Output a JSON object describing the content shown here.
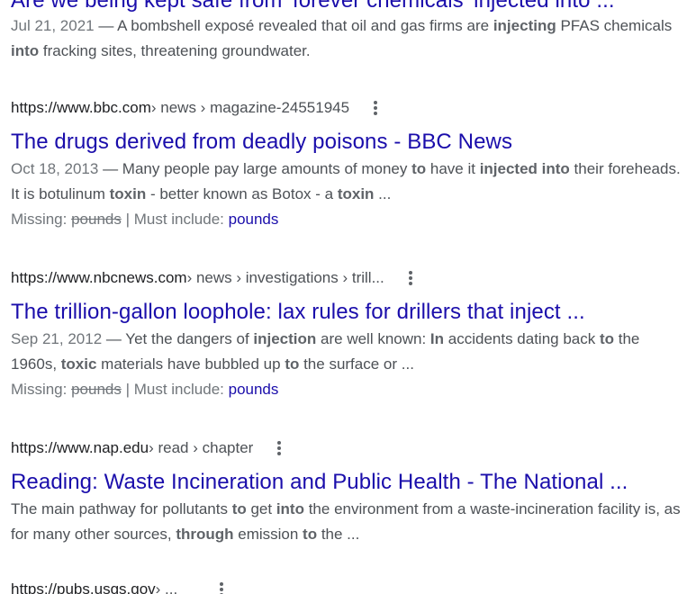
{
  "results": [
    {
      "title": "Are we being kept safe from 'forever chemicals' injected into ...",
      "date": "Jul 21, 2021",
      "snippet_parts": [
        {
          "t": " — A bombshell exposé revealed that oil and gas firms are ",
          "b": false
        },
        {
          "t": "injecting",
          "b": true
        },
        {
          "t": " PFAS chemicals ",
          "b": false
        },
        {
          "t": "into",
          "b": true
        },
        {
          "t": " fracking sites, threatening groundwater.",
          "b": false
        }
      ]
    },
    {
      "host": "https://www.bbc.com",
      "path": " › news › magazine-24551945",
      "title": "The drugs derived from deadly poisons - BBC News",
      "date": "Oct 18, 2013",
      "snippet_parts": [
        {
          "t": " — Many people pay large amounts of money ",
          "b": false
        },
        {
          "t": "to",
          "b": true
        },
        {
          "t": " have it ",
          "b": false
        },
        {
          "t": "injected into",
          "b": true
        },
        {
          "t": " their foreheads. It is botulinum ",
          "b": false
        },
        {
          "t": "toxin",
          "b": true
        },
        {
          "t": " - better known as Botox - a ",
          "b": false
        },
        {
          "t": "toxin",
          "b": true
        },
        {
          "t": " ...",
          "b": false
        }
      ],
      "missing_label": "Missing: ",
      "missing_term": "pounds",
      "must_include_label": " | Must include: ",
      "must_include_term": "pounds"
    },
    {
      "host": "https://www.nbcnews.com",
      "path": " › news › investigations › trill...",
      "title": "The trillion-gallon loophole: lax rules for drillers that inject ...",
      "date": "Sep 21, 2012",
      "snippet_parts": [
        {
          "t": " — Yet the dangers of ",
          "b": false
        },
        {
          "t": "injection",
          "b": true
        },
        {
          "t": " are well known: ",
          "b": false
        },
        {
          "t": "In",
          "b": true
        },
        {
          "t": " accidents dating back ",
          "b": false
        },
        {
          "t": "to",
          "b": true
        },
        {
          "t": " the 1960s, ",
          "b": false
        },
        {
          "t": "toxic",
          "b": true
        },
        {
          "t": " materials have bubbled up ",
          "b": false
        },
        {
          "t": "to",
          "b": true
        },
        {
          "t": " the surface or ...",
          "b": false
        }
      ],
      "missing_label": "Missing: ",
      "missing_term": "pounds",
      "must_include_label": " | Must include: ",
      "must_include_term": "pounds"
    },
    {
      "host": "https://www.nap.edu",
      "path": " › read › chapter",
      "title": "Reading: Waste Incineration and Public Health - The National ...",
      "snippet_parts": [
        {
          "t": "The main pathway for pollutants ",
          "b": false
        },
        {
          "t": "to",
          "b": true
        },
        {
          "t": " get ",
          "b": false
        },
        {
          "t": "into",
          "b": true
        },
        {
          "t": " the environment from a waste-incineration facility is, as for many other sources, ",
          "b": false
        },
        {
          "t": "through",
          "b": true
        },
        {
          "t": " emission ",
          "b": false
        },
        {
          "t": "to",
          "b": true
        },
        {
          "t": " the ...",
          "b": false
        }
      ]
    },
    {
      "host": "https://pubs.usgs.gov",
      "path": " › ..."
    }
  ]
}
